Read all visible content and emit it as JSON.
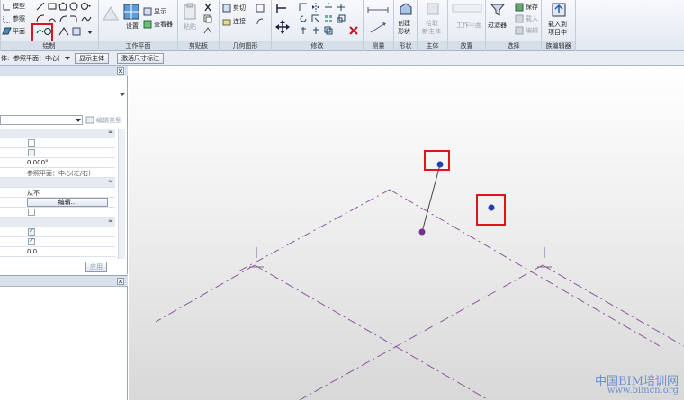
{
  "ribbon": {
    "draw": {
      "label": "绘制",
      "model": "模型",
      "ref": "参照",
      "plane": "平面"
    },
    "workplane": {
      "label": "工作平面",
      "show": "显示",
      "set": "设置",
      "viewer": "查看器"
    },
    "clipboard": {
      "label": "剪贴板",
      "paste": "粘贴"
    },
    "geometry": {
      "label": "几何图形",
      "cut": "剪切",
      "join": "连接"
    },
    "modify": {
      "label": "修改"
    },
    "measure": {
      "label": "测量"
    },
    "form": {
      "label": "形状",
      "create": "创建",
      "shape": "形状"
    },
    "host": {
      "label": "主体",
      "pick": "拾取",
      "new_host": "新主体"
    },
    "place": {
      "label": "放置",
      "workplane": "工作平面"
    },
    "select": {
      "label": "选择",
      "filter": "过滤器",
      "save": "保存",
      "load": "载入",
      "edit": "编辑"
    },
    "family_editor": {
      "label": "族编辑器",
      "load_into": "载入到",
      "project": "项目中"
    }
  },
  "options_bar": {
    "placement_prefix": "体:",
    "plane_label": "参照平面：中心(",
    "show_host": "显示主体",
    "temp_dim": "激活尺寸标注"
  },
  "properties": {
    "edit_type": "编辑类型",
    "row_value_angle": "0.000°",
    "row_ref_plane": "参照平面：中心(左/右)",
    "row_never": "从不",
    "edit_button": "编辑...",
    "row_zero": "0.0",
    "apply": "应用"
  },
  "watermark": {
    "line1": "中国BIM培训网",
    "line2": "www.bimcn.org"
  },
  "colors": {
    "highlight": "#e0141e",
    "point_blue": "#1f3fb5",
    "point_purple": "#7a2d8c",
    "ref_line": "#8a5a9a"
  }
}
